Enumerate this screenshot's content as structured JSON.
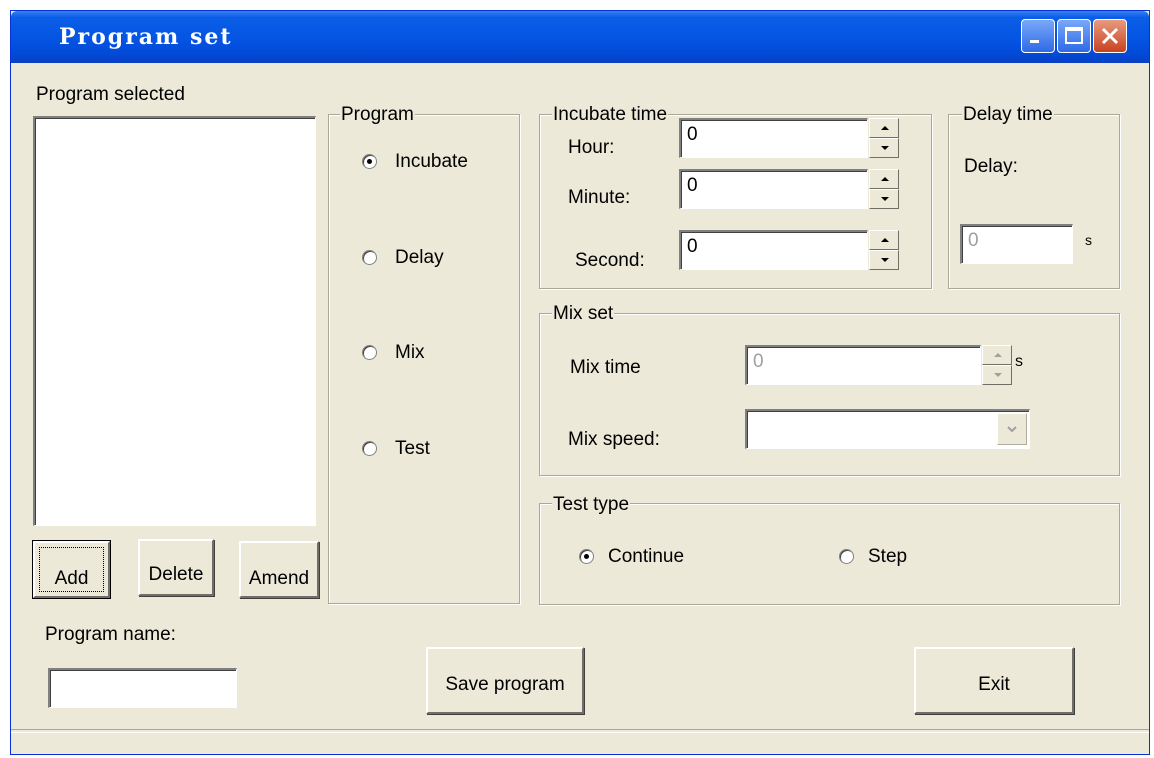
{
  "window": {
    "title": "Program set"
  },
  "program_selected": {
    "label": "Program selected",
    "items": []
  },
  "list_buttons": {
    "add": "Add",
    "delete": "Delete",
    "amend": "Amend"
  },
  "program_group": {
    "legend": "Program",
    "options": [
      {
        "label": "Incubate",
        "selected": true
      },
      {
        "label": "Delay",
        "selected": false
      },
      {
        "label": "Mix",
        "selected": false
      },
      {
        "label": "Test",
        "selected": false
      }
    ]
  },
  "incubate_time": {
    "legend": "Incubate time",
    "hour_label": "Hour:",
    "hour_value": "0",
    "minute_label": "Minute:",
    "minute_value": "0",
    "second_label": "Second:",
    "second_value": "0"
  },
  "delay_time": {
    "legend": "Delay time",
    "delay_label": "Delay:",
    "delay_value": "0",
    "unit": "s"
  },
  "mix_set": {
    "legend": "Mix set",
    "time_label": "Mix time",
    "time_value": "0",
    "time_unit": "s",
    "speed_label": "Mix speed:",
    "speed_value": ""
  },
  "test_type": {
    "legend": "Test type",
    "options": [
      {
        "label": "Continue",
        "selected": true
      },
      {
        "label": "Step",
        "selected": false
      }
    ]
  },
  "program_name": {
    "label": "Program name:",
    "value": ""
  },
  "actions": {
    "save": "Save program",
    "exit": "Exit"
  },
  "colors": {
    "titlebar": "#0554e3",
    "face": "#ece9d8",
    "close": "#c8421f"
  }
}
